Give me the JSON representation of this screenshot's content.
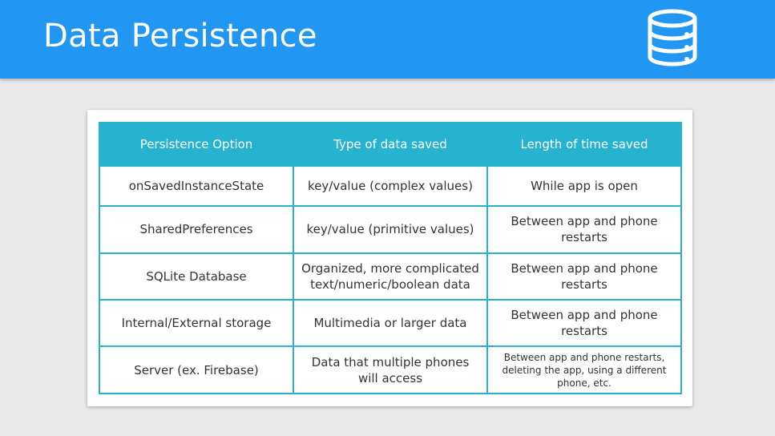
{
  "header": {
    "title": "Data Persistence",
    "icon": "database-icon",
    "background": "#2196f3"
  },
  "table": {
    "accent": "#26b3d0",
    "columns": [
      "Persistence Option",
      "Type of data saved",
      "Length of time saved"
    ],
    "rows": [
      [
        "onSavedInstanceState",
        "key/value (complex values)",
        "While app is open"
      ],
      [
        "SharedPreferences",
        "key/value (primitive values)",
        "Between app and phone restarts"
      ],
      [
        "SQLite Database",
        "Organized, more complicated text/numeric/boolean data",
        "Between app and phone restarts"
      ],
      [
        "Internal/External storage",
        "Multimedia or larger data",
        "Between app and phone restarts"
      ],
      [
        "Server (ex. Firebase)",
        "Data that multiple phones will access",
        "Between app and phone restarts, deleting the app, using a different phone, etc."
      ]
    ]
  }
}
